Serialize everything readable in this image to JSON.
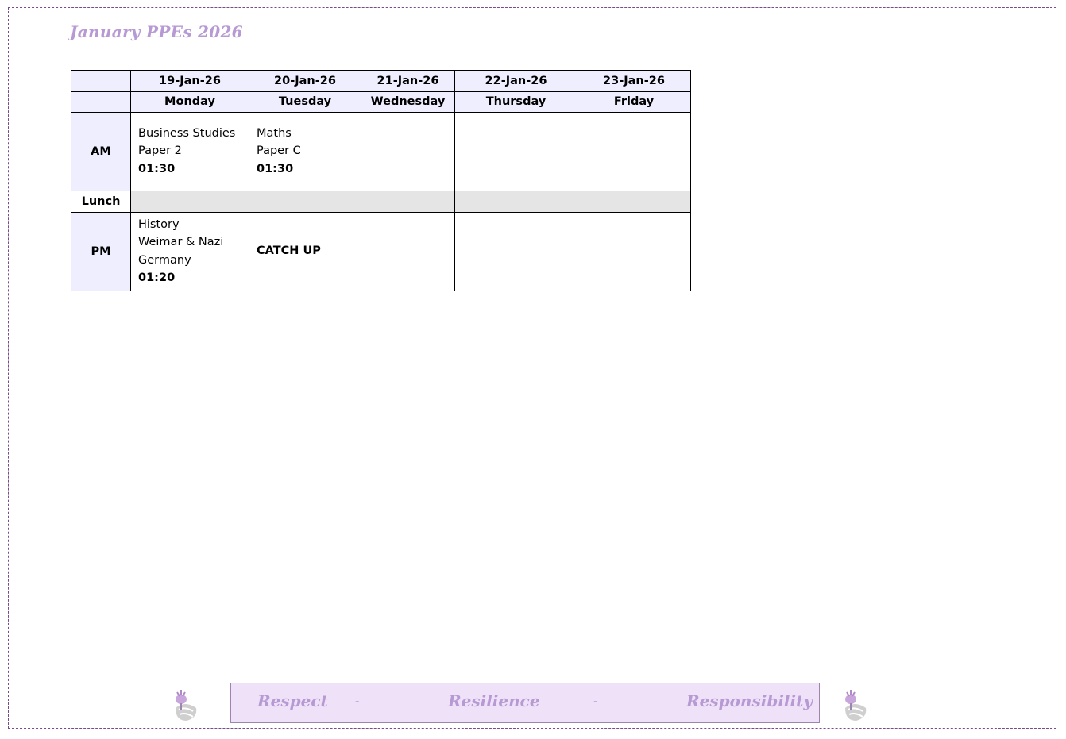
{
  "document": {
    "title": "January PPEs 2026"
  },
  "timetable": {
    "dates": [
      "19-Jan-26",
      "20-Jan-26",
      "21-Jan-26",
      "22-Jan-26",
      "23-Jan-26"
    ],
    "days": [
      "Monday",
      "Tuesday",
      "Wednesday",
      "Thursday",
      "Friday"
    ],
    "slots": {
      "am": "AM",
      "lunch": "Lunch",
      "pm": "PM"
    },
    "am": {
      "monday": {
        "subject": "Business Studies",
        "paper": "Paper 2",
        "duration": "01:30"
      },
      "tuesday": {
        "subject": "Maths",
        "paper": "Paper C",
        "duration": "01:30"
      }
    },
    "pm": {
      "monday": {
        "subject": "History",
        "paper_line1": "Weimar & Nazi",
        "paper_line2": "Germany",
        "duration": "01:20"
      },
      "tuesday": {
        "note": "CATCH UP"
      }
    }
  },
  "footer": {
    "mottos": [
      "Respect",
      "Resilience",
      "Responsibility"
    ],
    "separator": "-"
  },
  "colors": {
    "accent": "#b79ad4",
    "header_fill": "#eeeefe",
    "lunch_fill": "#e5e5e5",
    "footer_fill": "#efe1f8",
    "border_dashed": "#7a4a8f"
  },
  "icons": {
    "logo": "thistle-shell-icon"
  }
}
